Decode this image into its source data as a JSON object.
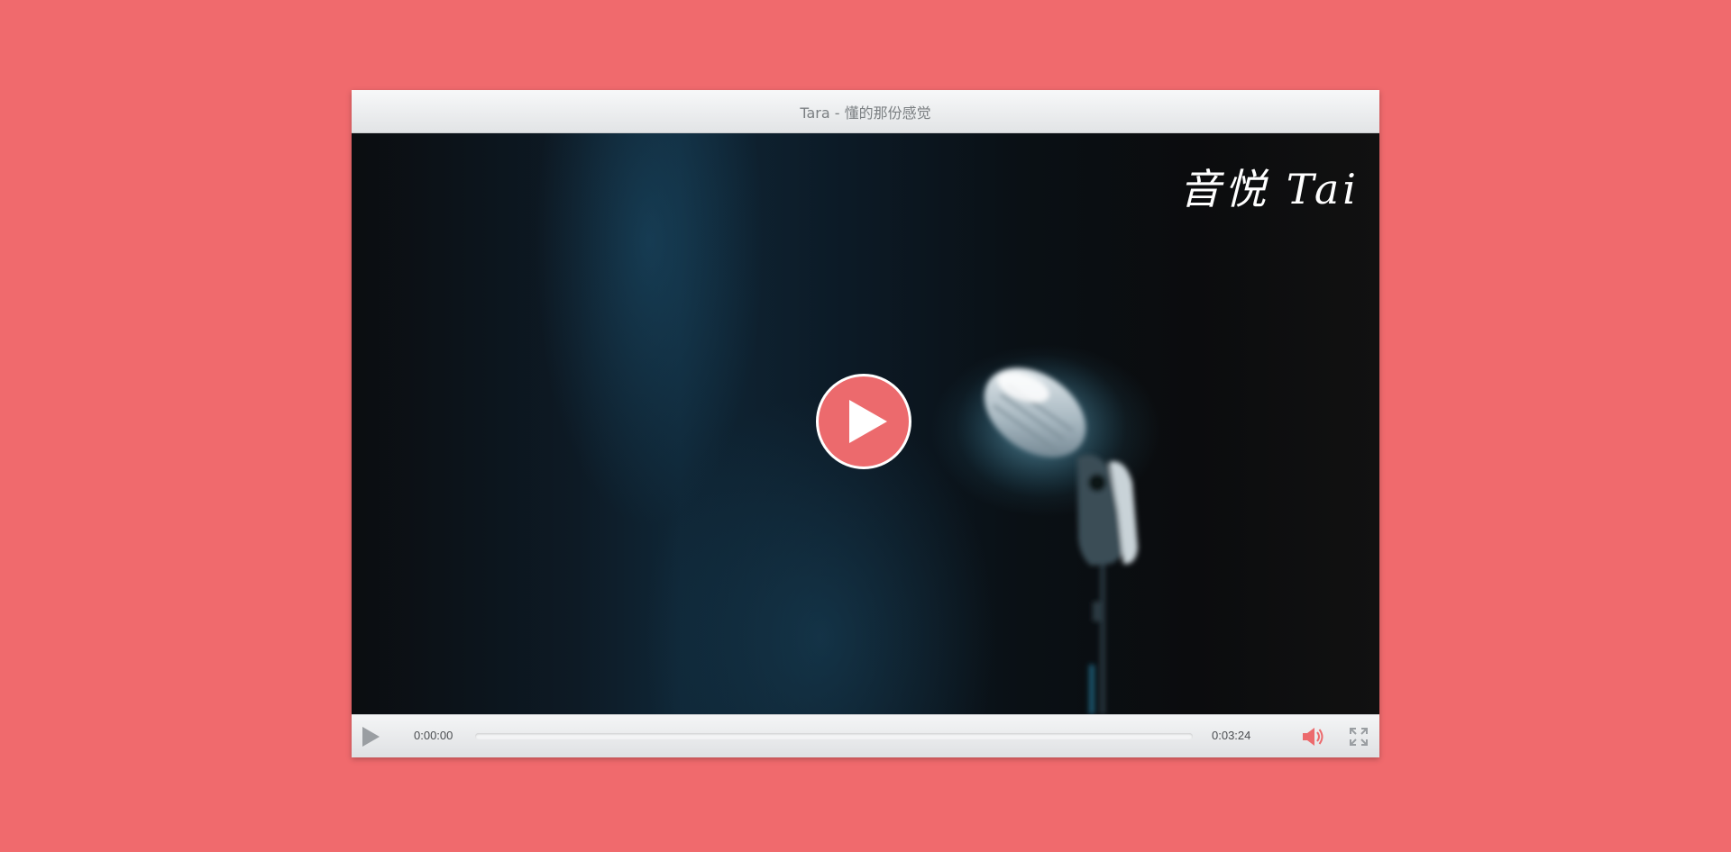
{
  "player": {
    "title": "Tara - 懂的那份感觉",
    "watermark": "音悦 Tai",
    "current_time": "0:00:00",
    "total_time": "0:03:24",
    "progress": 0,
    "muted": false
  },
  "icons": {
    "big_play": "play-icon",
    "play": "play-icon",
    "volume": "volume-icon",
    "fullscreen": "fullscreen-icon"
  },
  "colors": {
    "page_background": "#f06a6d",
    "accent": "#ec6a6d",
    "title_text": "#7b7f82",
    "control_icon": "#9a9ea2"
  }
}
